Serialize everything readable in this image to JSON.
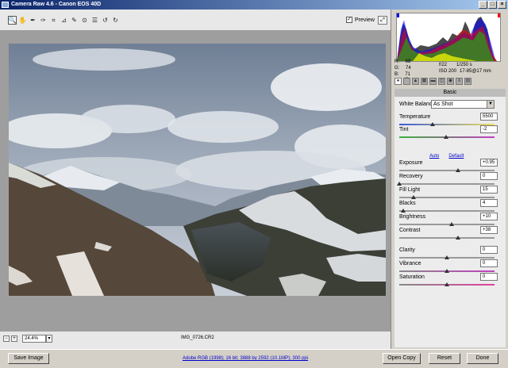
{
  "window": {
    "title": "Camera Raw 4.6  -  Canon EOS 40D"
  },
  "toolbar": {
    "tools": [
      "zoom-icon",
      "hand-icon",
      "white-balance-icon",
      "color-sampler-icon",
      "crop-icon",
      "straighten-icon",
      "retouch-icon",
      "red-eye-icon",
      "preferences-icon",
      "rotate-ccw-icon",
      "rotate-cw-icon"
    ],
    "preview_label": "Preview",
    "preview_checked": "✓"
  },
  "info": {
    "r_label": "R:",
    "r_value": "68",
    "g_label": "G:",
    "g_value": "74",
    "b_label": "B:",
    "b_value": "71",
    "aperture": "f/22",
    "shutter": "1/250 s",
    "iso": "ISO 200",
    "lens": "17-85@17 mm"
  },
  "panel": {
    "title": "Basic",
    "white_balance_label": "White Balance:",
    "white_balance_value": "As Shot",
    "auto_label": "Auto",
    "default_label": "Default",
    "sliders": [
      {
        "label": "Temperature",
        "value": "5500",
        "pos": 0.35
      },
      {
        "label": "Tint",
        "value": "-2",
        "pos": 0.49
      },
      {
        "label": "Exposure",
        "value": "+0.95",
        "pos": 0.62
      },
      {
        "label": "Recovery",
        "value": "0",
        "pos": 0.0
      },
      {
        "label": "Fill Light",
        "value": "15",
        "pos": 0.15
      },
      {
        "label": "Blacks",
        "value": "4",
        "pos": 0.04
      },
      {
        "label": "Brightness",
        "value": "+10",
        "pos": 0.55
      },
      {
        "label": "Contrast",
        "value": "+38",
        "pos": 0.62
      },
      {
        "label": "Clarity",
        "value": "0",
        "pos": 0.5
      },
      {
        "label": "Vibrance",
        "value": "0",
        "pos": 0.5
      },
      {
        "label": "Saturation",
        "value": "0",
        "pos": 0.5
      }
    ]
  },
  "status": {
    "zoom": "24.4%",
    "filename": "IMG_0726.CR2"
  },
  "footer": {
    "save_label": "Save Image",
    "workflow": "Adobe RGB (1998); 16 bit; 3888 by 2592 (10.1MP); 300 ppi",
    "open_label": "Open Copy",
    "reset_label": "Reset",
    "done_label": "Done"
  }
}
